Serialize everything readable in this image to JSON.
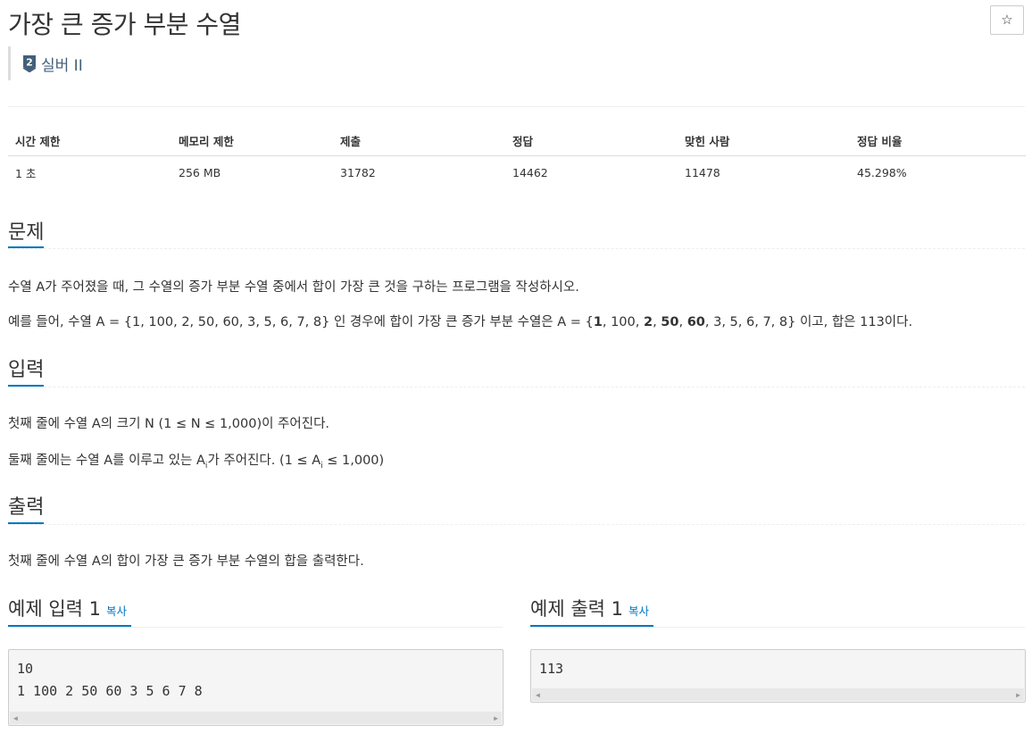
{
  "header": {
    "title": "가장 큰 증가 부분 수열",
    "star_label": "☆",
    "tier_number": "2",
    "tier_label": "실버 II"
  },
  "info_table": {
    "headers": [
      "시간 제한",
      "메모리 제한",
      "제출",
      "정답",
      "맞힌 사람",
      "정답 비율"
    ],
    "values": [
      "1 초",
      "256 MB",
      "31782",
      "14462",
      "11478",
      "45.298%"
    ]
  },
  "problem": {
    "heading": "문제",
    "p1": "수열 A가 주어졌을 때, 그 수열의 증가 부분 수열 중에서 합이 가장 큰 것을 구하는 프로그램을 작성하시오.",
    "p2_a": "예를 들어, 수열 A = {1, 100, 2, 50, 60, 3, 5, 6, 7, 8} 인 경우에 합이 가장 큰 증가 부분 수열은 A = {",
    "p2_b1": "1",
    "p2_c1": ", 100, ",
    "p2_b2": "2",
    "p2_c2": ", ",
    "p2_b3": "50",
    "p2_c3": ", ",
    "p2_b4": "60",
    "p2_d": ", 3, 5, 6, 7, 8} 이고, 합은 113이다."
  },
  "input": {
    "heading": "입력",
    "p1": "첫째 줄에 수열 A의 크기 N (1 ≤ N ≤ 1,000)이 주어진다.",
    "p2_a": "둘째 줄에는 수열 A를 이루고 있는 A",
    "p2_sub1": "i",
    "p2_b": "가 주어진다. (1 ≤ A",
    "p2_sub2": "i",
    "p2_c": " ≤ 1,000)"
  },
  "output": {
    "heading": "출력",
    "p1": "첫째 줄에 수열 A의 합이 가장 큰 증가 부분 수열의 합을 출력한다."
  },
  "sample_input": {
    "heading": "예제 입력 1",
    "copy_label": "복사",
    "line1": "10",
    "line2": "1 100 2 50 60 3 5 6 7 8"
  },
  "sample_output": {
    "heading": "예제 출력 1",
    "copy_label": "복사",
    "line1": "113"
  }
}
